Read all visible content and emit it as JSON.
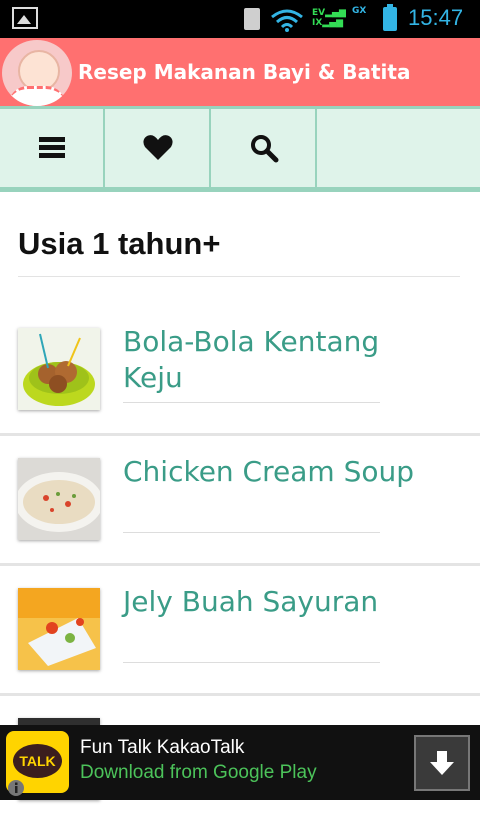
{
  "status_bar": {
    "time": "15:47",
    "signal_labels": [
      "EV",
      "IX",
      "G",
      "X"
    ]
  },
  "app": {
    "title": "Resep Makanan Bayi & Batita"
  },
  "toolbar": {
    "buttons": [
      {
        "icon": "menu-icon"
      },
      {
        "icon": "heart-icon"
      },
      {
        "icon": "search-icon"
      }
    ]
  },
  "section": {
    "title": "Usia 1 tahun+"
  },
  "recipes": [
    {
      "title": "Bola-Bola Kentang Keju"
    },
    {
      "title": "Chicken Cream Soup"
    },
    {
      "title": "Jely Buah Sayuran"
    }
  ],
  "ad": {
    "logo_text": "TALK",
    "title": "Fun Talk KakaoTalk",
    "subtitle": "Download from Google Play"
  },
  "colors": {
    "header": "#ff7070",
    "toolbar_bg": "#dff3ea",
    "toolbar_border": "#98d3bd",
    "recipe_title": "#3a9c87",
    "ad_cta": "#4cc35a",
    "status_accent": "#33b5e5"
  }
}
